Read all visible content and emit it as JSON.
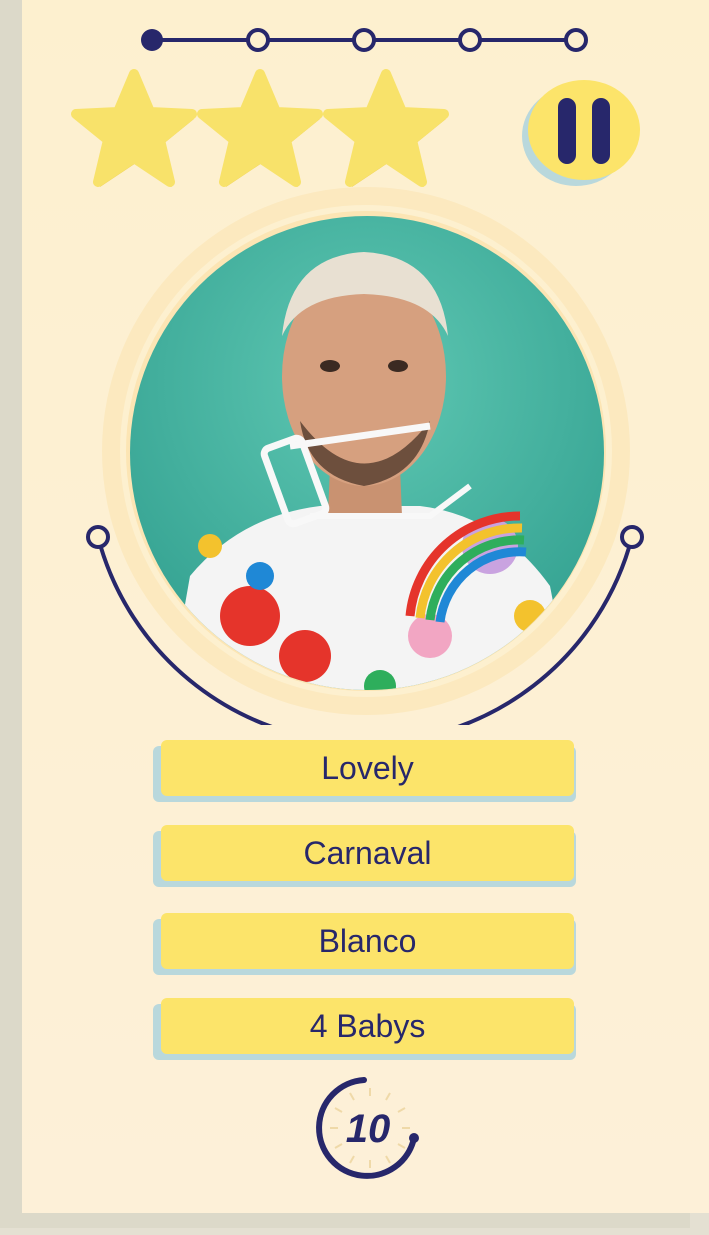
{
  "progress": {
    "total_steps": 5,
    "current_step": 1
  },
  "stars": {
    "earned": 3,
    "total": 3
  },
  "controls": {
    "pause_icon": "pause-icon"
  },
  "question": {
    "image": "portrait-photo"
  },
  "answers": [
    {
      "label": "Lovely"
    },
    {
      "label": "Carnaval"
    },
    {
      "label": "Blanco"
    },
    {
      "label": "4 Babys"
    }
  ],
  "timer": {
    "seconds": "10"
  },
  "colors": {
    "navy": "#27276b",
    "yellow": "#fce46a",
    "star": "#f8e26a",
    "light_blue": "#b9d8dc",
    "cream": "#fdf0cf",
    "teal": "#3aa796"
  }
}
